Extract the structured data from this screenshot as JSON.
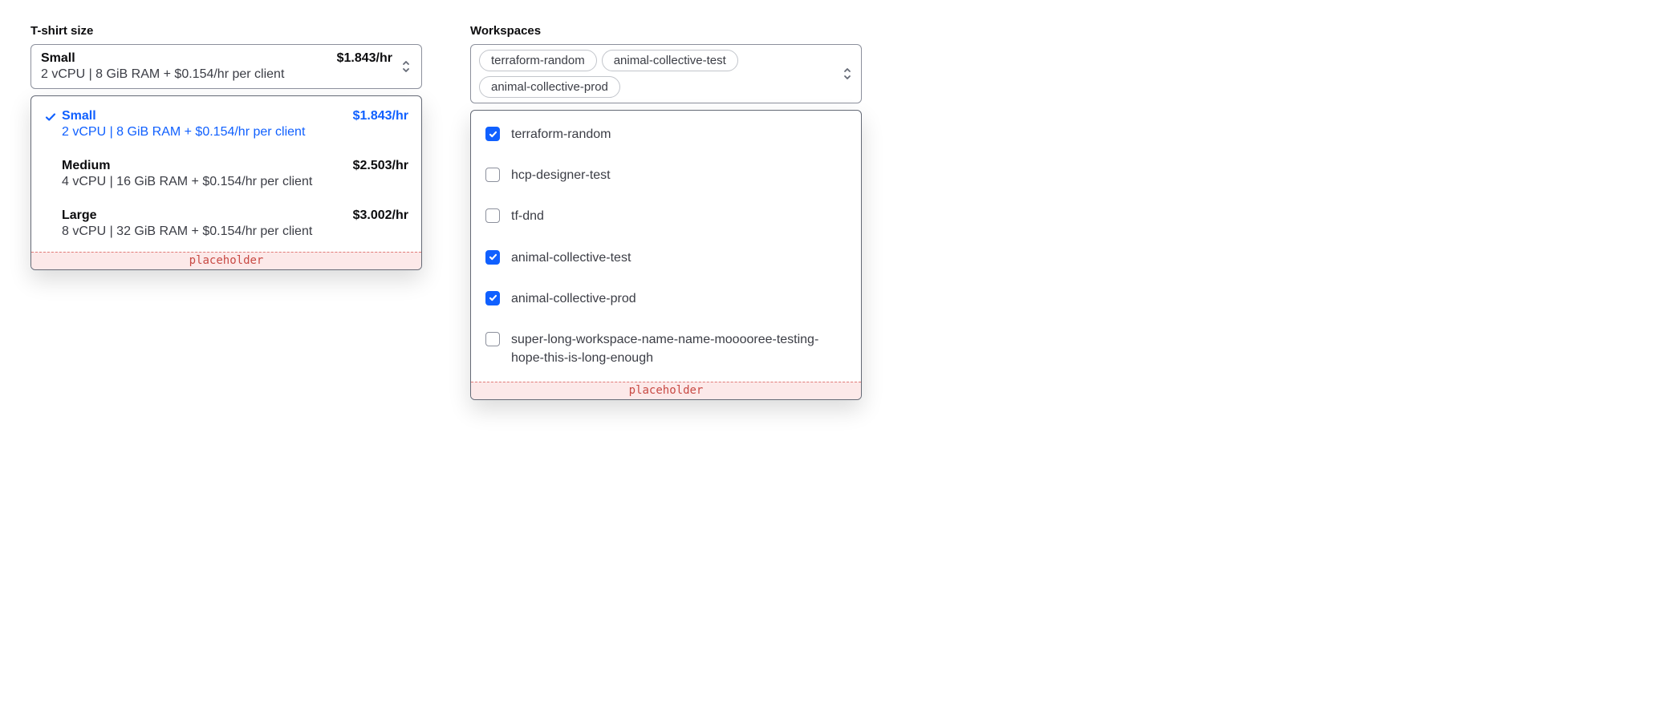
{
  "colors": {
    "accent": "#1060ff",
    "placeholder_bg": "#fce9e9",
    "placeholder_text": "#c84a44"
  },
  "placeholder_text": "placeholder",
  "tshirt": {
    "label": "T-shirt size",
    "selected_index": 0,
    "options": [
      {
        "title": "Small",
        "sub": "2 vCPU | 8 GiB RAM + $0.154/hr per client",
        "price": "$1.843/hr",
        "selected": true
      },
      {
        "title": "Medium",
        "sub": "4 vCPU | 16 GiB RAM + $0.154/hr per client",
        "price": "$2.503/hr",
        "selected": false
      },
      {
        "title": "Large",
        "sub": "8 vCPU | 32 GiB RAM + $0.154/hr per client",
        "price": "$3.002/hr",
        "selected": false
      }
    ]
  },
  "workspaces": {
    "label": "Workspaces",
    "selected": [
      "terraform-random",
      "animal-collective-test",
      "animal-collective-prod"
    ],
    "options": [
      {
        "label": "terraform-random",
        "checked": true
      },
      {
        "label": "hcp-designer-test",
        "checked": false
      },
      {
        "label": "tf-dnd",
        "checked": false
      },
      {
        "label": "animal-collective-test",
        "checked": true
      },
      {
        "label": "animal-collective-prod",
        "checked": true
      },
      {
        "label": "super-long-workspace-name-name-mooooree-testing-hope-this-is-long-enough",
        "checked": false
      }
    ]
  }
}
